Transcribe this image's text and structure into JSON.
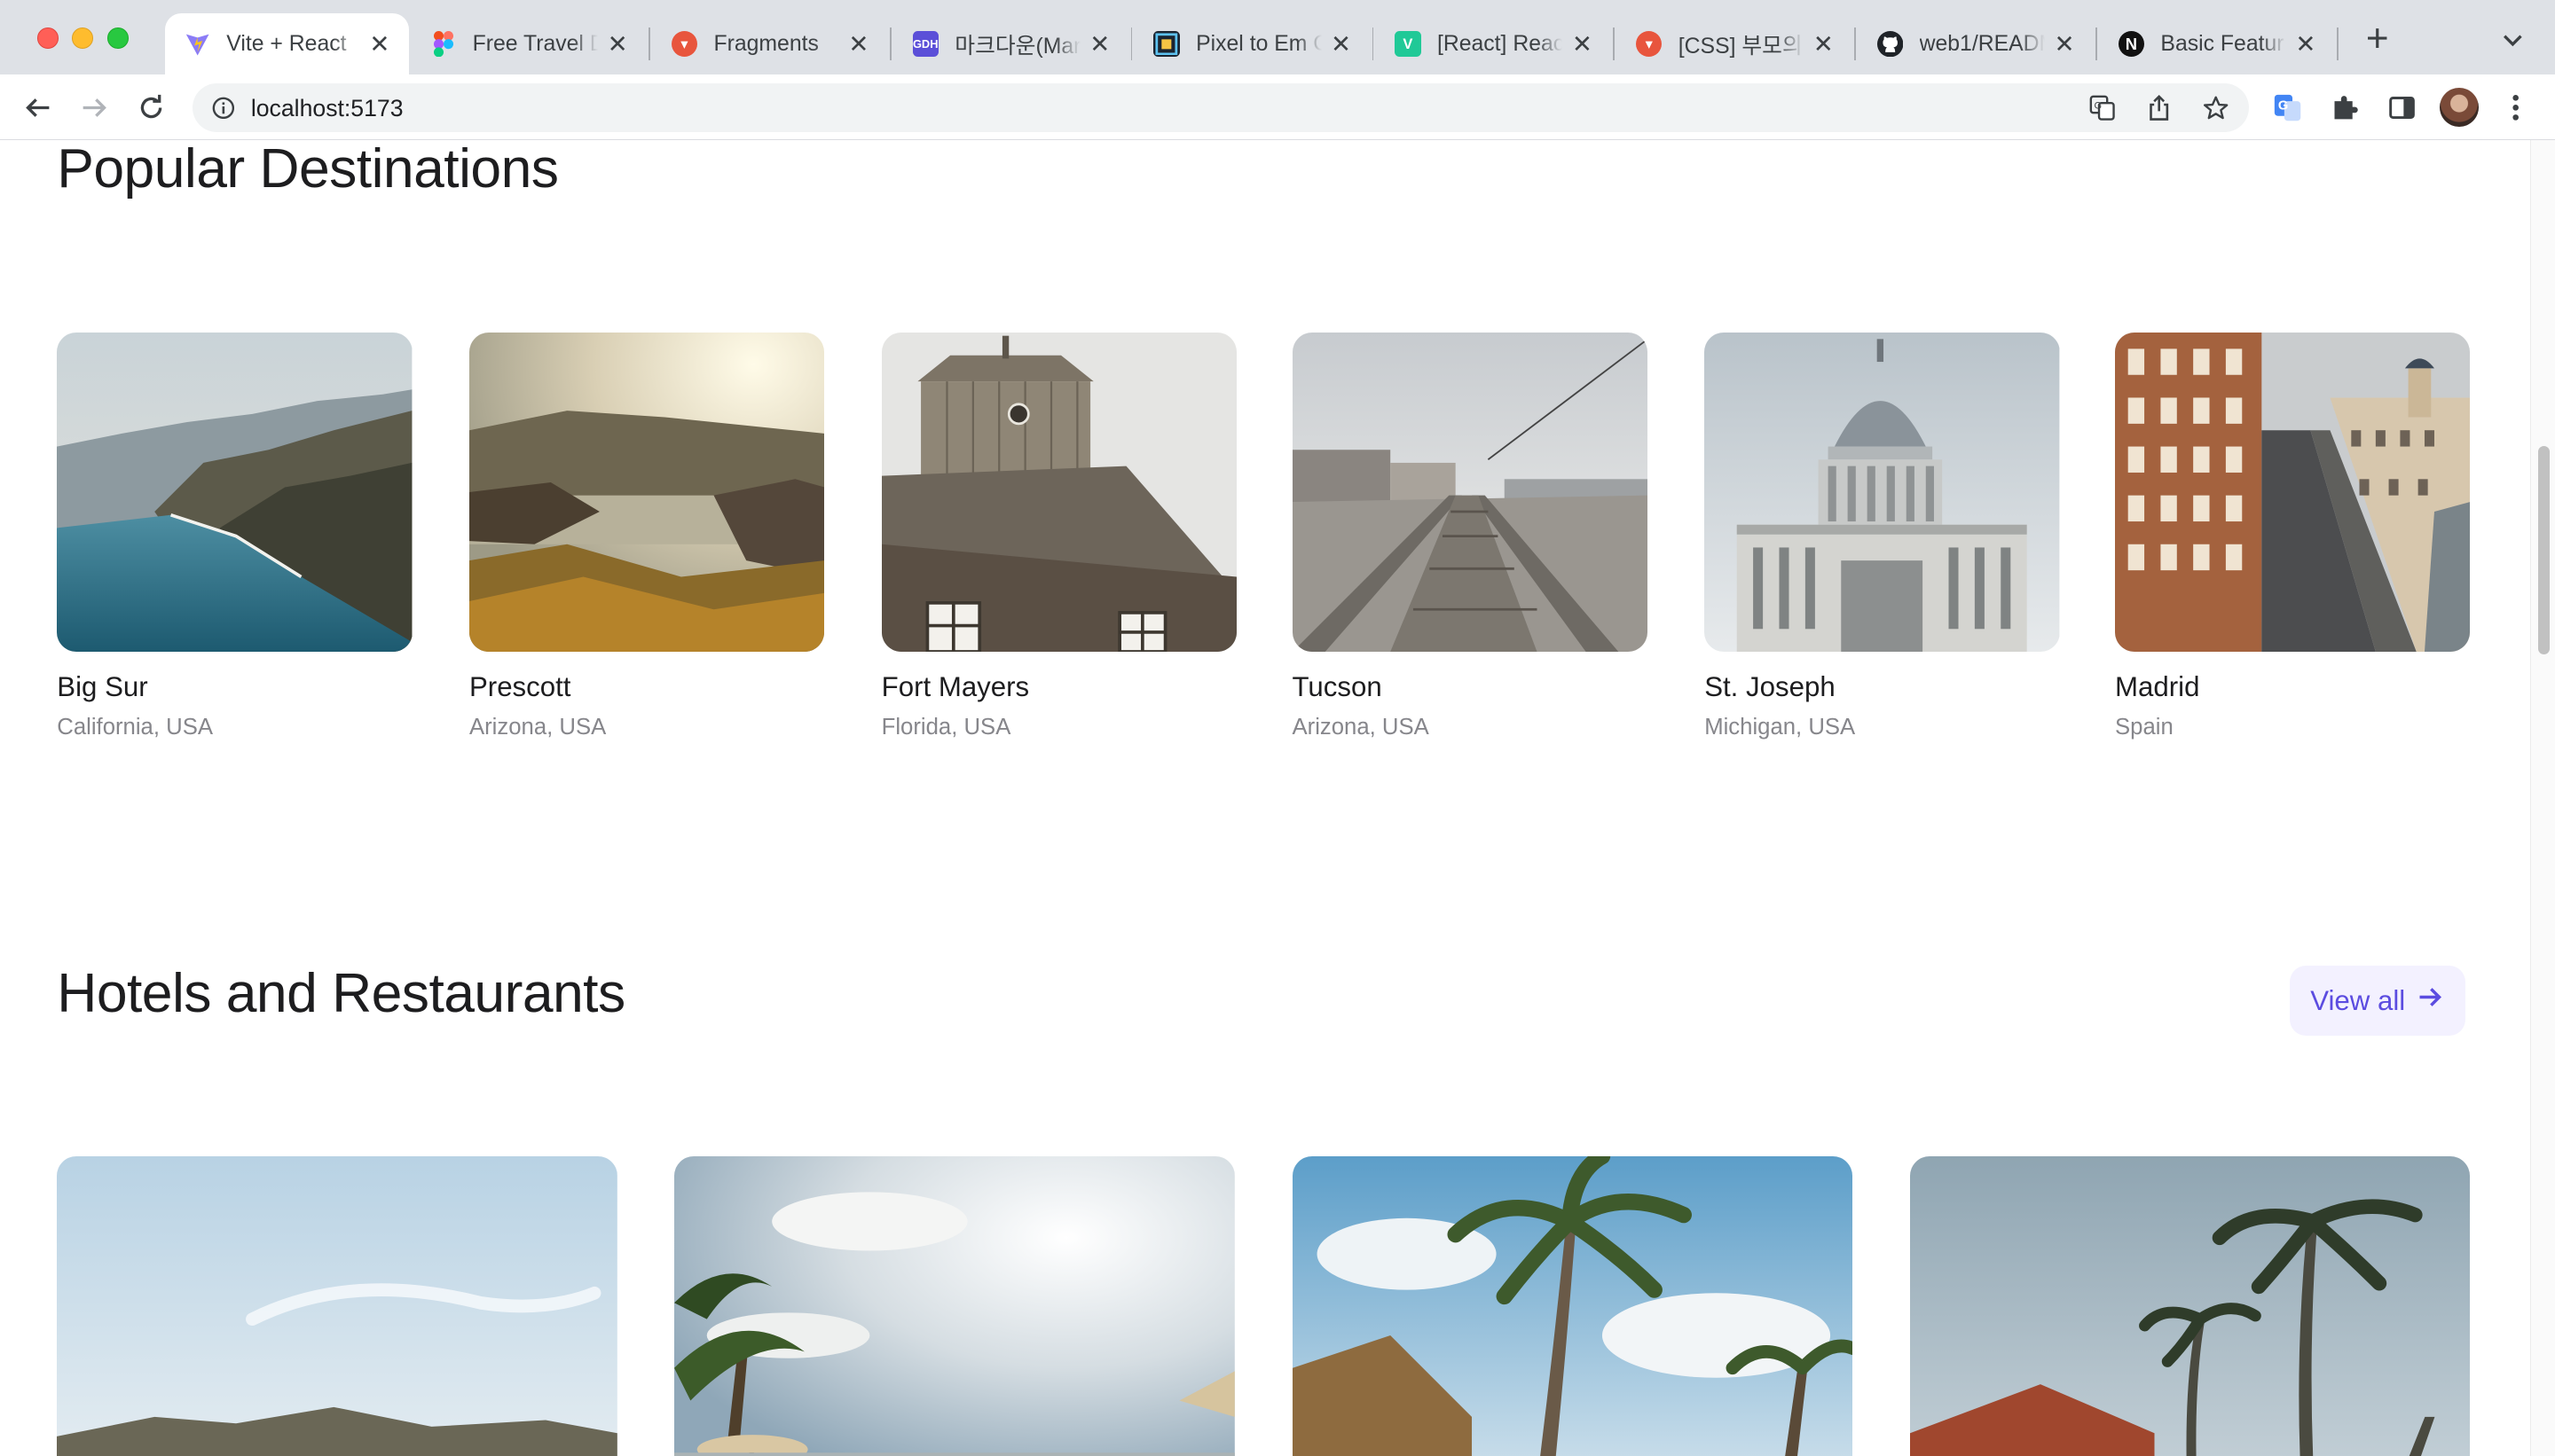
{
  "browser": {
    "tabs": [
      {
        "label": "Vite + React",
        "active": true,
        "icon": "vite-icon"
      },
      {
        "label": "Free Travel D",
        "icon": "figma-icon"
      },
      {
        "label": "Fragments",
        "icon": "velog-icon"
      },
      {
        "label": "마크다운(Mark",
        "icon": "gdh-icon"
      },
      {
        "label": "Pixel to Em C",
        "icon": "pixel-converter-icon"
      },
      {
        "label": "[React] Reac",
        "icon": "velog-v-icon"
      },
      {
        "label": "[CSS] 부모의",
        "icon": "velog-icon"
      },
      {
        "label": "web1/READM",
        "icon": "github-icon"
      },
      {
        "label": "Basic Featur",
        "icon": "notion-icon"
      }
    ],
    "new_tab_label": "+",
    "address": "localhost:5173",
    "close_glyph": "✕"
  },
  "page": {
    "popular": {
      "title": "Popular Destinations",
      "destinations": [
        {
          "name": "Big Sur",
          "region": "California, USA"
        },
        {
          "name": "Prescott",
          "region": "Arizona, USA"
        },
        {
          "name": "Fort Mayers",
          "region": "Florida, USA"
        },
        {
          "name": "Tucson",
          "region": "Arizona, USA"
        },
        {
          "name": "St. Joseph",
          "region": "Michigan, USA"
        },
        {
          "name": "Madrid",
          "region": "Spain"
        }
      ]
    },
    "hotels": {
      "title": "Hotels and Restaurants",
      "view_all_label": "View all"
    }
  },
  "colors": {
    "accent": "#5b4ce0",
    "accent_bg": "#f3f1ff",
    "text_primary": "#1d1d1f",
    "text_secondary": "#86868b"
  }
}
